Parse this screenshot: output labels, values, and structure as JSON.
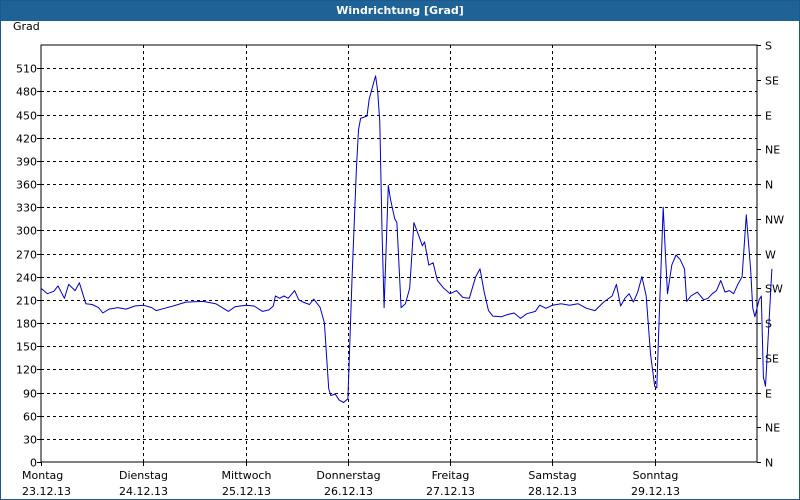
{
  "window": {
    "title": "Windrichtung [Grad]"
  },
  "chart_data": {
    "type": "line",
    "title": "Windrichtung [Grad]",
    "ylabel": "Grad",
    "ylim": [
      0,
      540
    ],
    "yticks": [
      0,
      30,
      60,
      90,
      120,
      150,
      180,
      210,
      240,
      270,
      300,
      330,
      360,
      390,
      420,
      450,
      480,
      510
    ],
    "y2ticks": [
      {
        "value": 0,
        "label": "N"
      },
      {
        "value": 45,
        "label": "NE"
      },
      {
        "value": 90,
        "label": "E"
      },
      {
        "value": 135,
        "label": "SE"
      },
      {
        "value": 180,
        "label": "S"
      },
      {
        "value": 225,
        "label": "SW"
      },
      {
        "value": 270,
        "label": "W"
      },
      {
        "value": 315,
        "label": "NW"
      },
      {
        "value": 360,
        "label": "N"
      },
      {
        "value": 405,
        "label": "NE"
      },
      {
        "value": 450,
        "label": "E"
      },
      {
        "value": 495,
        "label": "SE"
      },
      {
        "value": 540,
        "label": "S"
      }
    ],
    "xlim": [
      "2013-12-23T00:00",
      "2013-12-30T00:00"
    ],
    "xticks": [
      {
        "x": "2013-12-23T00:00",
        "day": "Montag",
        "date": "23.12.13"
      },
      {
        "x": "2013-12-24T00:00",
        "day": "Dienstag",
        "date": "24.12.13"
      },
      {
        "x": "2013-12-25T00:00",
        "day": "Mittwoch",
        "date": "25.12.13"
      },
      {
        "x": "2013-12-26T00:00",
        "day": "Donnerstag",
        "date": "26.12.13"
      },
      {
        "x": "2013-12-27T00:00",
        "day": "Freitag",
        "date": "27.12.13"
      },
      {
        "x": "2013-12-28T00:00",
        "day": "Samstag",
        "date": "28.12.13"
      },
      {
        "x": "2013-12-29T00:00",
        "day": "Sonntag",
        "date": "29.12.13"
      }
    ],
    "grid": true,
    "series": [
      {
        "color": "#0000cc",
        "points": [
          [
            "2013-12-23T00:00",
            225
          ],
          [
            "2013-12-23T01:30",
            218
          ],
          [
            "2013-12-23T03:00",
            221
          ],
          [
            "2013-12-23T04:00",
            228
          ],
          [
            "2013-12-23T05:30",
            212
          ],
          [
            "2013-12-23T06:30",
            230
          ],
          [
            "2013-12-23T08:00",
            222
          ],
          [
            "2013-12-23T09:00",
            232
          ],
          [
            "2013-12-23T10:30",
            205
          ],
          [
            "2013-12-23T12:00",
            204
          ],
          [
            "2013-12-23T13:30",
            200
          ],
          [
            "2013-12-23T14:30",
            193
          ],
          [
            "2013-12-23T16:00",
            198
          ],
          [
            "2013-12-23T18:00",
            200
          ],
          [
            "2013-12-23T20:00",
            198
          ],
          [
            "2013-12-23T22:00",
            202
          ],
          [
            "2013-12-24T00:00",
            203
          ],
          [
            "2013-12-24T02:00",
            200
          ],
          [
            "2013-12-24T03:00",
            196
          ],
          [
            "2013-12-24T05:00",
            199
          ],
          [
            "2013-12-24T07:00",
            202
          ],
          [
            "2013-12-24T10:00",
            207
          ],
          [
            "2013-12-24T14:00",
            208
          ],
          [
            "2013-12-24T17:00",
            205
          ],
          [
            "2013-12-24T20:00",
            195
          ],
          [
            "2013-12-24T21:30",
            201
          ],
          [
            "2013-12-25T00:00",
            203
          ],
          [
            "2013-12-25T02:00",
            202
          ],
          [
            "2013-12-25T04:00",
            195
          ],
          [
            "2013-12-25T05:30",
            197
          ],
          [
            "2013-12-25T06:30",
            202
          ],
          [
            "2013-12-25T07:00",
            215
          ],
          [
            "2013-12-25T08:00",
            212
          ],
          [
            "2013-12-25T09:00",
            215
          ],
          [
            "2013-12-25T10:00",
            212
          ],
          [
            "2013-12-25T11:30",
            222
          ],
          [
            "2013-12-25T12:30",
            210
          ],
          [
            "2013-12-25T13:30",
            207
          ],
          [
            "2013-12-25T15:00",
            204
          ],
          [
            "2013-12-25T16:00",
            211
          ],
          [
            "2013-12-25T17:30",
            200
          ],
          [
            "2013-12-25T18:30",
            180
          ],
          [
            "2013-12-25T19:30",
            95
          ],
          [
            "2013-12-25T20:00",
            86
          ],
          [
            "2013-12-25T21:00",
            88
          ],
          [
            "2013-12-25T22:00",
            80
          ],
          [
            "2013-12-25T23:00",
            77
          ],
          [
            "2013-12-26T00:00",
            82
          ],
          [
            "2013-12-26T01:00",
            240
          ],
          [
            "2013-12-26T02:00",
            380
          ],
          [
            "2013-12-26T02:30",
            430
          ],
          [
            "2013-12-26T03:00",
            445
          ],
          [
            "2013-12-26T04:30",
            448
          ],
          [
            "2013-12-26T05:00",
            470
          ],
          [
            "2013-12-26T06:00",
            490
          ],
          [
            "2013-12-26T06:30",
            500
          ],
          [
            "2013-12-26T07:00",
            480
          ],
          [
            "2013-12-26T07:30",
            440
          ],
          [
            "2013-12-26T08:00",
            300
          ],
          [
            "2013-12-26T08:30",
            200
          ],
          [
            "2013-12-26T09:30",
            358
          ],
          [
            "2013-12-26T10:00",
            340
          ],
          [
            "2013-12-26T11:00",
            315
          ],
          [
            "2013-12-26T11:30",
            310
          ],
          [
            "2013-12-26T12:30",
            200
          ],
          [
            "2013-12-26T13:30",
            205
          ],
          [
            "2013-12-26T14:30",
            225
          ],
          [
            "2013-12-26T15:30",
            310
          ],
          [
            "2013-12-26T16:30",
            295
          ],
          [
            "2013-12-26T17:30",
            280
          ],
          [
            "2013-12-26T18:00",
            285
          ],
          [
            "2013-12-26T19:00",
            255
          ],
          [
            "2013-12-26T20:00",
            258
          ],
          [
            "2013-12-26T21:00",
            235
          ],
          [
            "2013-12-26T22:30",
            225
          ],
          [
            "2013-12-27T00:00",
            218
          ],
          [
            "2013-12-27T01:30",
            222
          ],
          [
            "2013-12-27T03:00",
            213
          ],
          [
            "2013-12-27T04:30",
            212
          ],
          [
            "2013-12-27T06:00",
            240
          ],
          [
            "2013-12-27T07:00",
            250
          ],
          [
            "2013-12-27T08:00",
            220
          ],
          [
            "2013-12-27T09:00",
            196
          ],
          [
            "2013-12-27T10:00",
            189
          ],
          [
            "2013-12-27T12:00",
            188
          ],
          [
            "2013-12-27T13:30",
            191
          ],
          [
            "2013-12-27T15:00",
            193
          ],
          [
            "2013-12-27T16:30",
            186
          ],
          [
            "2013-12-27T18:00",
            192
          ],
          [
            "2013-12-27T20:00",
            195
          ],
          [
            "2013-12-27T21:00",
            203
          ],
          [
            "2013-12-27T22:30",
            199
          ],
          [
            "2013-12-28T00:00",
            203
          ],
          [
            "2013-12-28T02:00",
            205
          ],
          [
            "2013-12-28T04:00",
            203
          ],
          [
            "2013-12-28T06:00",
            205
          ],
          [
            "2013-12-28T08:00",
            199
          ],
          [
            "2013-12-28T10:00",
            196
          ],
          [
            "2013-12-28T12:00",
            207
          ],
          [
            "2013-12-28T14:00",
            215
          ],
          [
            "2013-12-28T15:00",
            230
          ],
          [
            "2013-12-28T16:00",
            202
          ],
          [
            "2013-12-28T17:00",
            212
          ],
          [
            "2013-12-28T18:00",
            218
          ],
          [
            "2013-12-28T19:00",
            207
          ],
          [
            "2013-12-28T20:00",
            220
          ],
          [
            "2013-12-28T21:00",
            240
          ],
          [
            "2013-12-28T22:00",
            215
          ],
          [
            "2013-12-28T23:00",
            140
          ],
          [
            "2013-12-29T00:00",
            98
          ],
          [
            "2013-12-29T00:30",
            96
          ],
          [
            "2013-12-29T01:00",
            180
          ],
          [
            "2013-12-29T02:00",
            330
          ],
          [
            "2013-12-29T02:30",
            270
          ],
          [
            "2013-12-29T03:00",
            218
          ],
          [
            "2013-12-29T04:00",
            255
          ],
          [
            "2013-12-29T05:00",
            268
          ],
          [
            "2013-12-29T06:00",
            262
          ],
          [
            "2013-12-29T07:00",
            250
          ],
          [
            "2013-12-29T07:30",
            208
          ],
          [
            "2013-12-29T08:30",
            215
          ],
          [
            "2013-12-29T10:00",
            220
          ],
          [
            "2013-12-29T11:30",
            210
          ],
          [
            "2013-12-29T12:30",
            212
          ],
          [
            "2013-12-29T13:30",
            218
          ],
          [
            "2013-12-29T14:30",
            222
          ],
          [
            "2013-12-29T15:30",
            235
          ],
          [
            "2013-12-29T16:30",
            220
          ],
          [
            "2013-12-29T17:30",
            222
          ],
          [
            "2013-12-29T18:30",
            218
          ],
          [
            "2013-12-29T19:30",
            230
          ],
          [
            "2013-12-29T20:30",
            240
          ],
          [
            "2013-12-29T21:30",
            320
          ],
          [
            "2013-12-29T22:30",
            250
          ],
          [
            "2013-12-29T23:00",
            200
          ],
          [
            "2013-12-29T23:30",
            188
          ],
          [
            "2013-12-30T00:30",
            210
          ],
          [
            "2013-12-30T01:00",
            215
          ],
          [
            "2013-12-30T01:30",
            110
          ],
          [
            "2013-12-30T02:00",
            98
          ],
          [
            "2013-12-30T03:00",
            200
          ],
          [
            "2013-12-30T03:30",
            250
          ]
        ]
      }
    ]
  }
}
